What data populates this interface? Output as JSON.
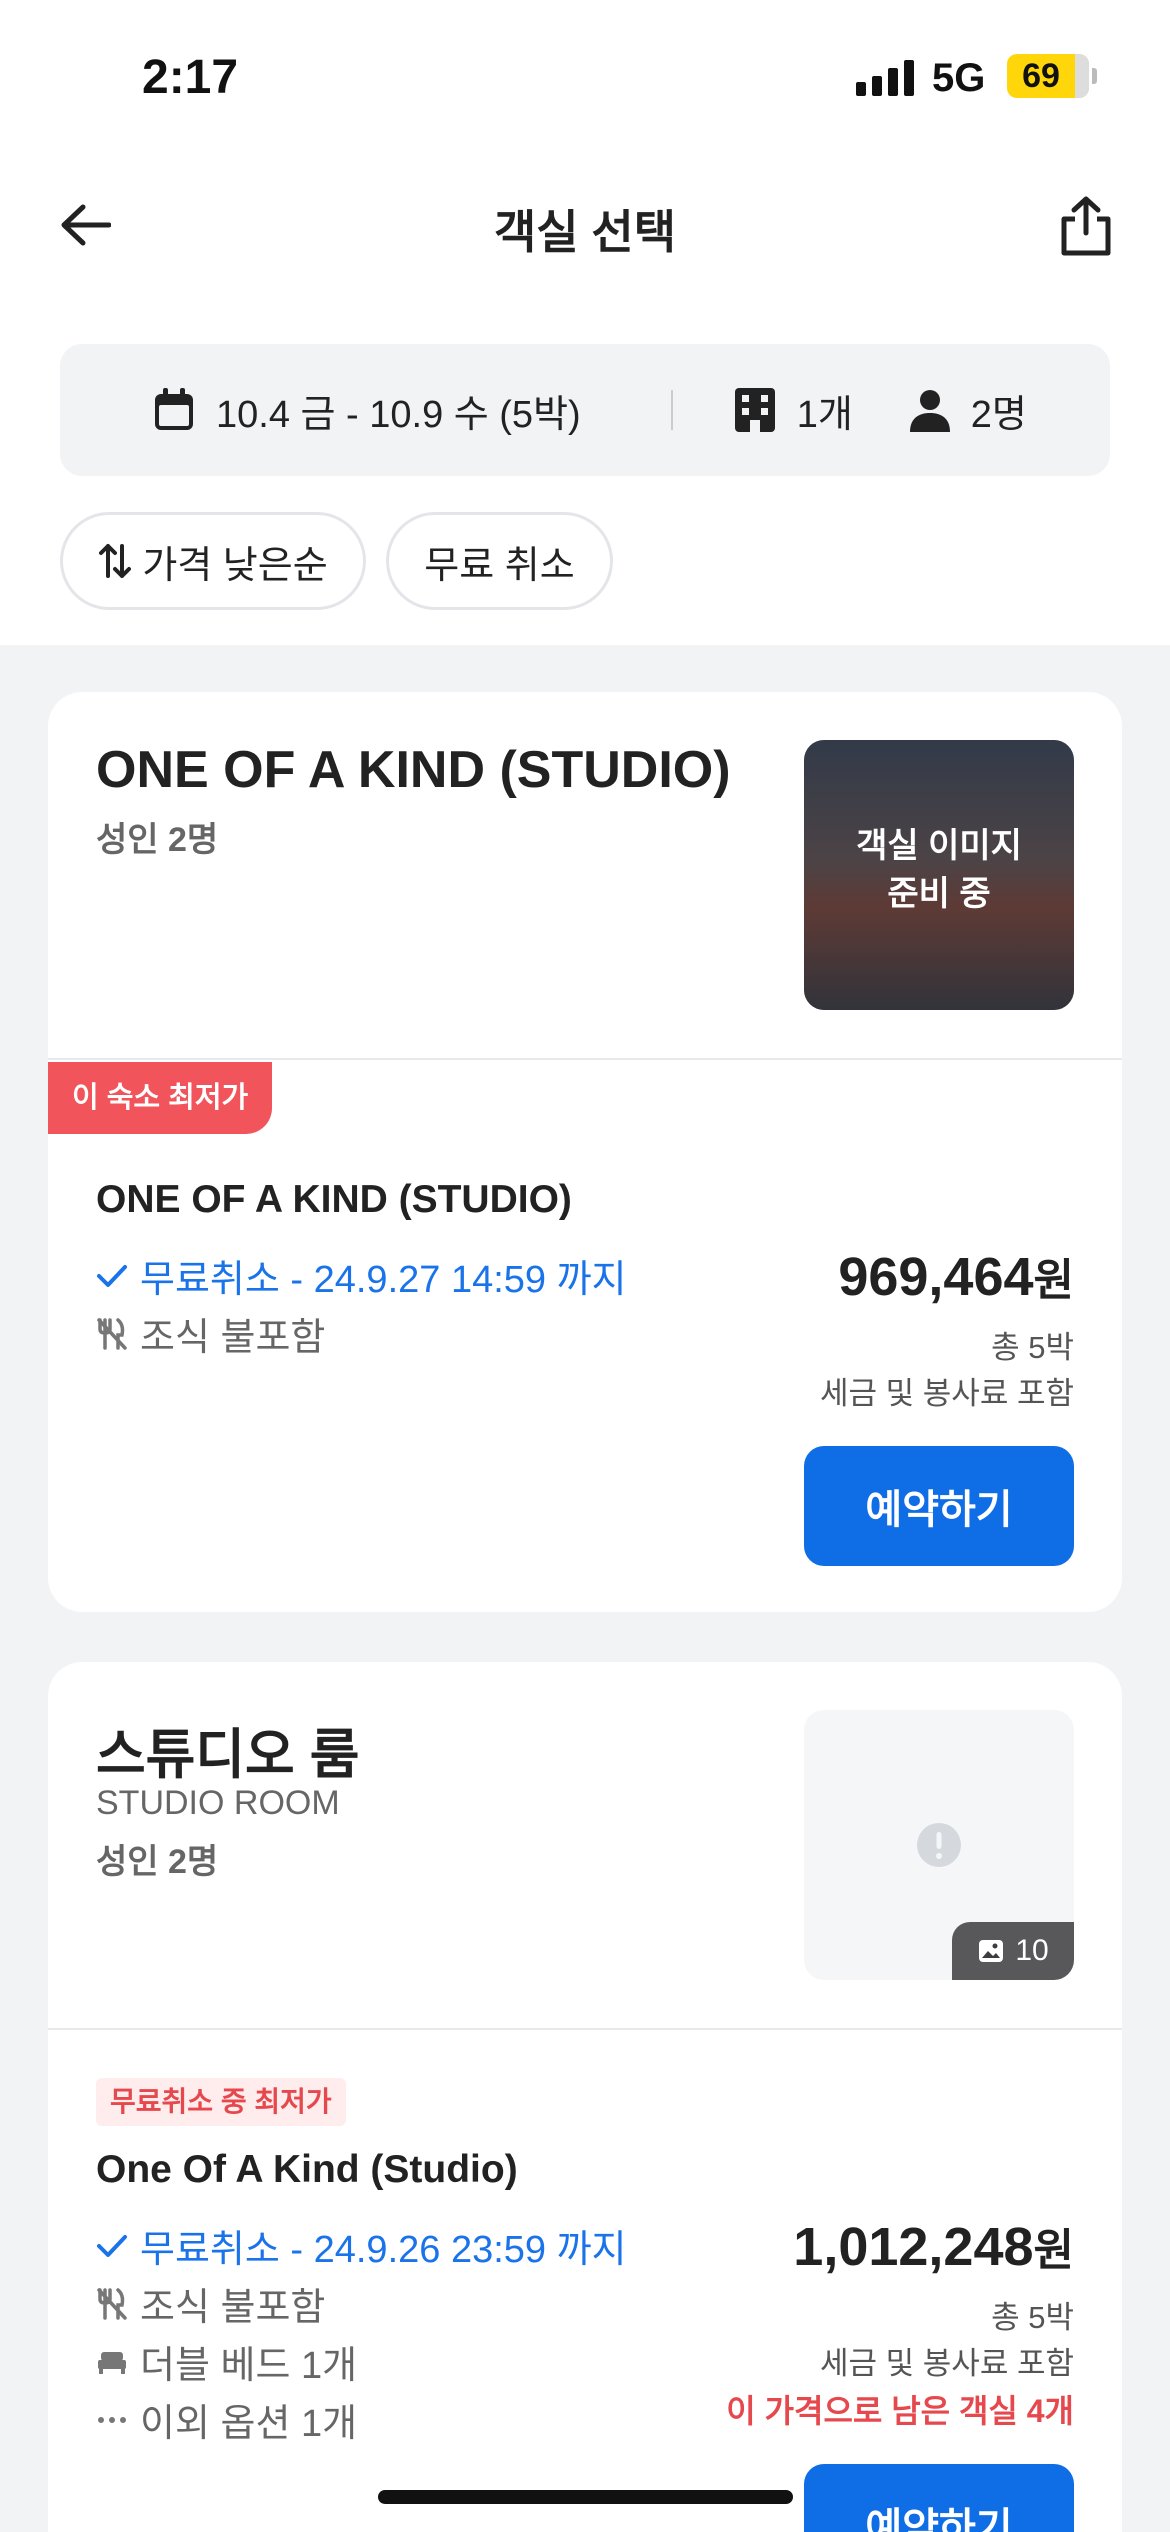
{
  "status_bar": {
    "time": "2:17",
    "network": "5G",
    "battery": "69"
  },
  "header": {
    "title": "객실 선택"
  },
  "search": {
    "dates": "10.4 금 - 10.9 수 (5박)",
    "rooms": "1개",
    "guests": "2명"
  },
  "filters": {
    "sort_label": "가격 낮은순",
    "free_cancel_label": "무료 취소"
  },
  "rooms": [
    {
      "name": "ONE OF A KIND (STUDIO)",
      "capacity": "성인 2명",
      "image_overlay": "객실 이미지\n준비 중",
      "plan": {
        "badge": "이 숙소 최저가",
        "name": "ONE OF A KIND (STUDIO)",
        "free_cancel": "무료취소 - 24.9.27 14:59 까지",
        "breakfast": "조식 불포함",
        "price": "969,464",
        "currency": "원",
        "nights": "총 5박",
        "tax_note": "세금 및 봉사료 포함",
        "book_label": "예약하기"
      }
    },
    {
      "name": "스튜디오 룸",
      "name_en": "STUDIO ROOM",
      "capacity": "성인 2명",
      "photo_count": "10",
      "plan": {
        "badge": "무료취소 중 최저가",
        "name": "One Of A Kind (Studio)",
        "free_cancel": "무료취소 - 24.9.26 23:59 까지",
        "breakfast": "조식 불포함",
        "bed": "더블 베드 1개",
        "options": "이외 옵션 1개",
        "price": "1,012,248",
        "currency": "원",
        "nights": "총 5박",
        "tax_note": "세금 및 봉사료 포함",
        "remaining": "이 가격으로 남은 객실 4개",
        "book_label": "예약하기"
      }
    }
  ],
  "colors": {
    "accent": "#0f6de5",
    "badge_red": "#f2545b",
    "free_blue": "#1a73e8"
  }
}
